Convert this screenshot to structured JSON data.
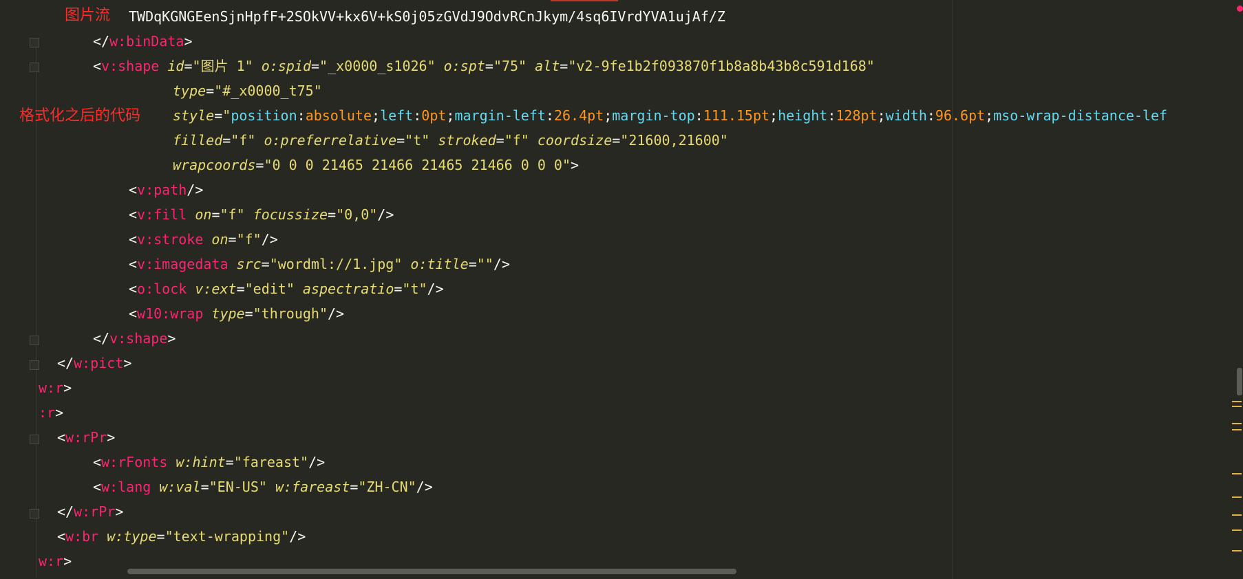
{
  "annotations": {
    "image_stream": "图片流",
    "formatted_code": "格式化之后的代码"
  },
  "lines": {
    "l0": "TWDqKGNGEenSjnHpfF+2SOkVV+kx6V+kS0j05zGVdJ9OdvRCnJkym/4sq6IVrdYVA1ujAf/Z",
    "l1": {
      "open": "</",
      "tag": "w:binData",
      "close": ">"
    },
    "l2": {
      "open": "<",
      "tag": "v:shape",
      "a1": "id",
      "v1": "\"图片 1\"",
      "a2": "o:spid",
      "v2": "\"_x0000_s1026\"",
      "a3": "o:spt",
      "v3": "\"75\"",
      "a4": "alt",
      "v4": "\"v2-9fe1b2f093870f1b8a8b43b8c591d168\""
    },
    "l3": {
      "a1": "type",
      "v1": "\"#_x0000_t75\""
    },
    "l4": {
      "a1": "style",
      "q": "\"",
      "p1": "position",
      "c1": "absolute",
      "p2": "left",
      "c2": "0pt",
      "p3": "margin-left",
      "c3": "26.4pt",
      "p4": "margin-top",
      "c4": "111.15pt",
      "p5": "height",
      "c5": "128pt",
      "p6": "width",
      "c6": "96.6pt",
      "p7": "mso-wrap-distance-lef"
    },
    "l5": {
      "a1": "filled",
      "v1": "\"f\"",
      "a2": "o:preferrelative",
      "v2": "\"t\"",
      "a3": "stroked",
      "v3": "\"f\"",
      "a4": "coordsize",
      "v4": "\"21600,21600\""
    },
    "l6": {
      "a1": "wrapcoords",
      "v1": "\"0 0 0 21465 21466 21465 21466 0 0 0\"",
      "close": ">"
    },
    "l7": {
      "open": "<",
      "tag": "v:path",
      "close": "/>"
    },
    "l8": {
      "open": "<",
      "tag": "v:fill",
      "a1": "on",
      "v1": "\"f\"",
      "a2": "focussize",
      "v2": "\"0,0\"",
      "close": "/>"
    },
    "l9": {
      "open": "<",
      "tag": "v:stroke",
      "a1": "on",
      "v1": "\"f\"",
      "close": "/>"
    },
    "l10": {
      "open": "<",
      "tag": "v:imagedata",
      "a1": "src",
      "v1": "\"wordml://1.jpg\"",
      "a2": "o:title",
      "v2": "\"\"",
      "close": "/>"
    },
    "l11": {
      "open": "<",
      "tag": "o:lock",
      "a1": "v:ext",
      "v1": "\"edit\"",
      "a2": "aspectratio",
      "v2": "\"t\"",
      "close": "/>"
    },
    "l12": {
      "open": "<",
      "tag": "w10:wrap",
      "a1": "type",
      "v1": "\"through\"",
      "close": "/>"
    },
    "l13": {
      "open": "</",
      "tag": "v:shape",
      "close": ">"
    },
    "l14": {
      "open": "</",
      "tag": "w:pict",
      "close": ">"
    },
    "l15": {
      "tag": "w:r",
      "close": ">"
    },
    "l16": {
      "tag": ":r",
      "close": ">"
    },
    "l17": {
      "open": "<",
      "tag": "w:rPr",
      "close": ">"
    },
    "l18": {
      "open": "<",
      "tag": "w:rFonts",
      "a1": "w:hint",
      "v1": "\"fareast\"",
      "close": "/>"
    },
    "l19": {
      "open": "<",
      "tag": "w:lang",
      "a1": "w:val",
      "v1": "\"EN-US\"",
      "a2": "w:fareast",
      "v2": "\"ZH-CN\"",
      "close": "/>"
    },
    "l20": {
      "open": "</",
      "tag": "w:rPr",
      "close": ">"
    },
    "l21": {
      "open": "<",
      "tag": "w:br",
      "a1": "w:type",
      "v1": "\"text-wrapping\"",
      "close": "/>"
    },
    "l22": {
      "tag": "w:r",
      "close": ">"
    }
  }
}
